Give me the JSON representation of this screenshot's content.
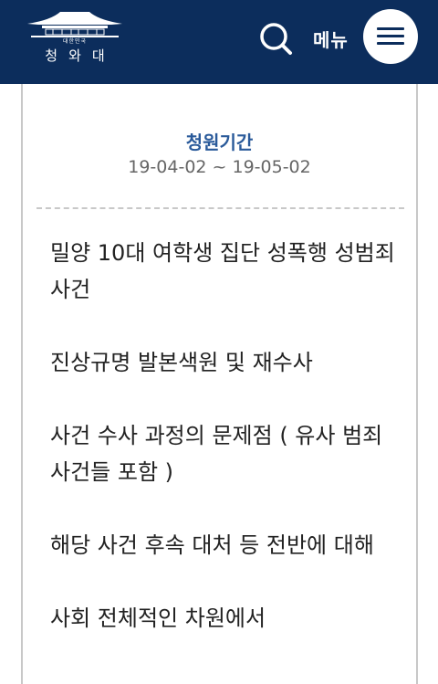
{
  "header": {
    "logo_small": "대한민국",
    "logo_main": "청와대",
    "menu_label": "메뉴"
  },
  "period": {
    "title": "청원기간",
    "range": "19-04-02 ~ 19-05-02"
  },
  "items": [
    "밀양 10대 여학생 집단 성폭행 성범죄 사건",
    "진상규명 발본색원 및 재수사",
    "사건 수사 과정의 문제점 ( 유사 범죄 사건들 포함 )",
    "해당 사건 후속 대처 등 전반에 대해",
    "사회 전체적인 차원에서"
  ],
  "colors": {
    "header_bg": "#0c2d5c",
    "accent": "#2a5a9a"
  }
}
